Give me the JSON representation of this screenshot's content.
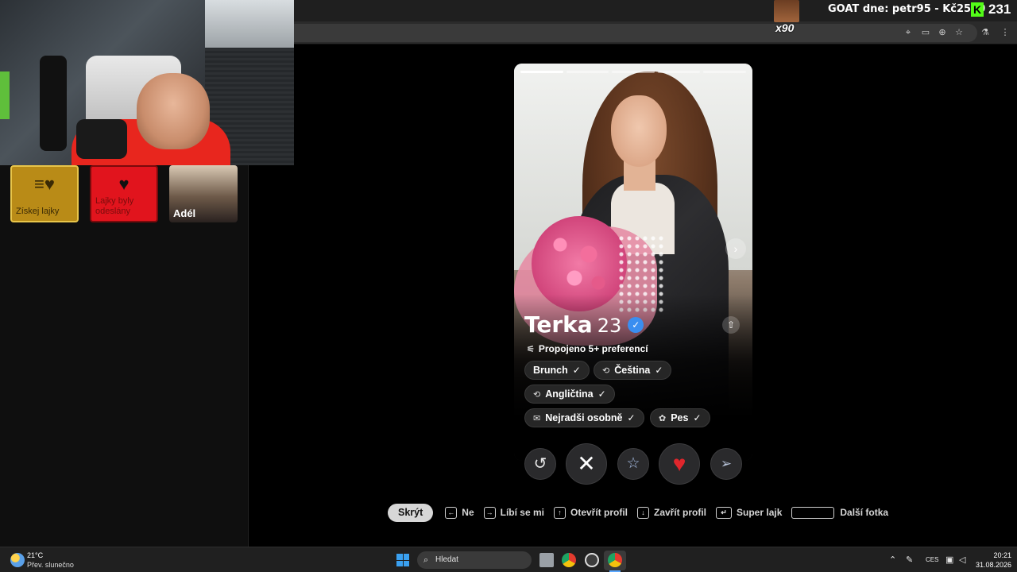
{
  "overlay": {
    "goat_text": "GOAT dne: petr95 - Kč2550",
    "kick_logo": "K",
    "viewer_count": "231",
    "multiplier": "x90"
  },
  "browser": {
    "toolbar_icons": [
      "location-icon",
      "cast-icon",
      "zoom-icon",
      "bookmark-star-icon",
      "labs-icon",
      "menu-icon"
    ]
  },
  "left_panel": {
    "tiles": [
      {
        "label": "Získej lajky",
        "icon": "boost-heart-icon"
      },
      {
        "label": "Lajky byly odeslány",
        "icon": "heart-icon"
      },
      {
        "label": "Adél",
        "icon": "profile-photo"
      }
    ]
  },
  "profile": {
    "photo_count": 5,
    "active_photo": 1,
    "name": "Terka",
    "age": "23",
    "verified": true,
    "preferences": "Propojeno 5+ preferencí",
    "chips": [
      {
        "label": "Brunch",
        "icon": "",
        "check": "✓"
      },
      {
        "label": "Čeština",
        "icon": "⟲",
        "check": "✓"
      },
      {
        "label": "Angličtina",
        "icon": "⟲",
        "check": "✓"
      },
      {
        "label": "Nejradši osobně",
        "icon": "✉",
        "check": "✓"
      },
      {
        "label": "Pes",
        "icon": "✿",
        "check": "✓"
      }
    ]
  },
  "actions": {
    "undo": "↺",
    "nope": "✕",
    "super_like": "☆",
    "like": "♥",
    "boost": "➢"
  },
  "hints": {
    "hide": "Skrýt",
    "no": "Ne",
    "like": "Líbí se mi",
    "open_profile": "Otevřít profil",
    "close_profile": "Zavřít profil",
    "super_like": "Super lajk",
    "next_photo": "Další fotka"
  },
  "taskbar": {
    "temperature": "21°C",
    "weather": "Přev. slunečno",
    "search": "Hledat",
    "language": "CES",
    "time": "20:21",
    "date": "31.08.2026"
  },
  "colors": {
    "accent_like": "#e0262c",
    "gold_tile": "#b98b17",
    "red_tile": "#e1141d",
    "verified": "#3a8ef0",
    "kick_green": "#53fc18"
  }
}
